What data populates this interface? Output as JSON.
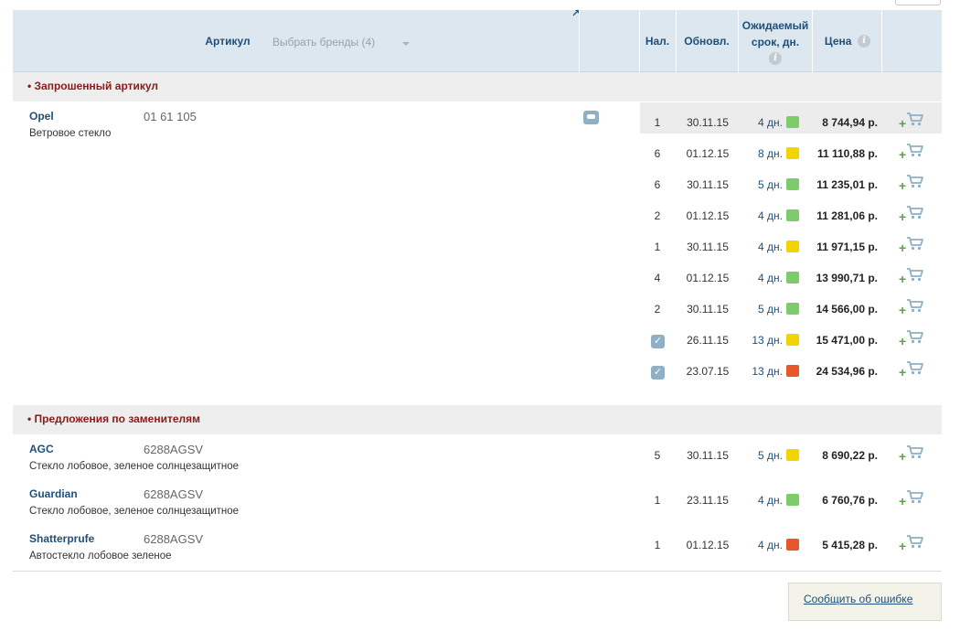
{
  "header": {
    "article_label": "Артикул",
    "brand_select": "Выбрать бренды (4)",
    "ext_link": "↗",
    "qty_label": "Нал.",
    "updated_label": "Обновл.",
    "expected_label_1": "Ожидаемый",
    "expected_label_2": "срок, дн.",
    "price_label": "Цена",
    "info_glyph": "i"
  },
  "sections": {
    "requested_title": "• Запрошенный артикул",
    "substitutes_title": "• Предложения по заменителям"
  },
  "requested": {
    "brand": "Opel",
    "article": "01 61 105",
    "description": "Ветровое стекло",
    "offers": [
      {
        "qty": "1",
        "date": "30.11.15",
        "days": "4 дн.",
        "status": "green",
        "price": "8 744,94 р."
      },
      {
        "qty": "6",
        "date": "01.12.15",
        "days": "8 дн.",
        "status": "yellow",
        "price": "11 110,88 р."
      },
      {
        "qty": "6",
        "date": "30.11.15",
        "days": "5 дн.",
        "status": "green",
        "price": "11 235,01 р."
      },
      {
        "qty": "2",
        "date": "01.12.15",
        "days": "4 дн.",
        "status": "green",
        "price": "11 281,06 р."
      },
      {
        "qty": "1",
        "date": "30.11.15",
        "days": "4 дн.",
        "status": "yellow",
        "price": "11 971,15 р."
      },
      {
        "qty": "4",
        "date": "01.12.15",
        "days": "4 дн.",
        "status": "green",
        "price": "13 990,71 р."
      },
      {
        "qty": "2",
        "date": "30.11.15",
        "days": "5 дн.",
        "status": "green",
        "price": "14 566,00 р."
      },
      {
        "qty": "",
        "checked": true,
        "date": "26.11.15",
        "days": "13 дн.",
        "status": "yellow",
        "price": "15 471,00 р."
      },
      {
        "qty": "",
        "checked": true,
        "date": "23.07.15",
        "days": "13 дн.",
        "status": "red",
        "price": "24 534,96 р."
      }
    ]
  },
  "substitutes": [
    {
      "brand": "AGC",
      "article": "6288AGSV",
      "description": "Стекло лобовое, зеленое солнцезащитное",
      "offer": {
        "qty": "5",
        "date": "30.11.15",
        "days": "5 дн.",
        "status": "yellow",
        "price": "8 690,22 р."
      }
    },
    {
      "brand": "Guardian",
      "article": "6288AGSV",
      "description": "Стекло лобовое, зеленое солнцезащитное",
      "offer": {
        "qty": "1",
        "date": "23.11.15",
        "days": "4 дн.",
        "status": "green",
        "price": "6 760,76 р."
      }
    },
    {
      "brand": "Shatterprufe",
      "article": "6288AGSV",
      "description": "Автостекло лобовое зеленое",
      "offer": {
        "qty": "1",
        "date": "01.12.15",
        "days": "4 дн.",
        "status": "red",
        "price": "5 415,28 р."
      }
    }
  ],
  "colors": {
    "green": "#7dcc6a",
    "yellow": "#f2d500",
    "red": "#e8572a",
    "accent": "#1f4f7a",
    "section_title": "#8b1a1a"
  },
  "cart": {
    "plus": "+",
    "check": "✓"
  },
  "report_link": "Сообщить об ошибке"
}
